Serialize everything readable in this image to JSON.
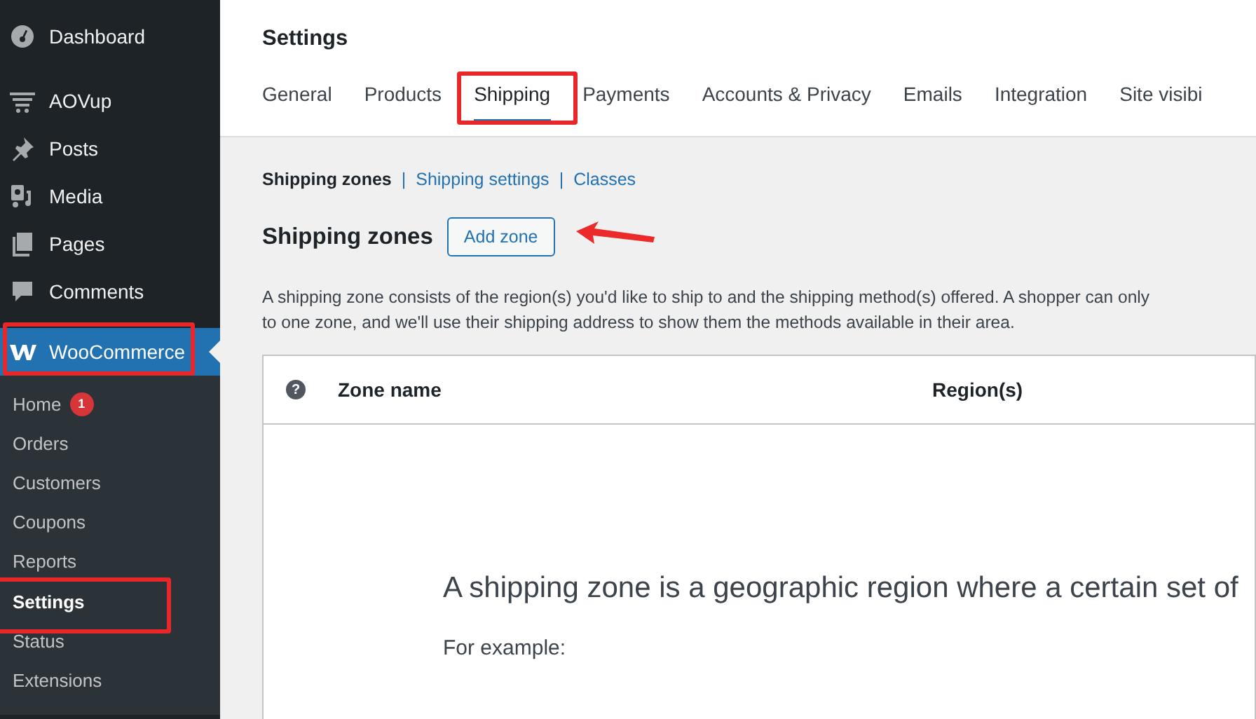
{
  "sidebar": {
    "items": [
      {
        "label": "Dashboard",
        "kind": "gauge",
        "selected": false
      },
      {
        "label": "AOVup",
        "kind": "cart",
        "selected": false
      },
      {
        "label": "Posts",
        "kind": "pin",
        "selected": false
      },
      {
        "label": "Media",
        "kind": "media",
        "selected": false
      },
      {
        "label": "Pages",
        "kind": "pages",
        "selected": false
      },
      {
        "label": "Comments",
        "kind": "comment",
        "selected": false
      },
      {
        "label": "WooCommerce",
        "kind": "woo",
        "selected": true,
        "highlighted": true
      }
    ],
    "submenu": [
      {
        "label": "Home",
        "badge": "1",
        "selected": false,
        "highlighted": false
      },
      {
        "label": "Orders",
        "selected": false,
        "highlighted": false
      },
      {
        "label": "Customers",
        "selected": false,
        "highlighted": false
      },
      {
        "label": "Coupons",
        "selected": false,
        "highlighted": false
      },
      {
        "label": "Reports",
        "selected": false,
        "highlighted": false
      },
      {
        "label": "Settings",
        "selected": true,
        "highlighted": true
      },
      {
        "label": "Status",
        "selected": false,
        "highlighted": false
      },
      {
        "label": "Extensions",
        "selected": false,
        "highlighted": false
      }
    ]
  },
  "page_title": "Settings",
  "tabs": [
    {
      "label": "General",
      "selected": false,
      "highlighted": false
    },
    {
      "label": "Products",
      "selected": false,
      "highlighted": false
    },
    {
      "label": "Shipping",
      "selected": true,
      "highlighted": true
    },
    {
      "label": "Payments",
      "selected": false,
      "highlighted": false
    },
    {
      "label": "Accounts & Privacy",
      "selected": false,
      "highlighted": false
    },
    {
      "label": "Emails",
      "selected": false,
      "highlighted": false
    },
    {
      "label": "Integration",
      "selected": false,
      "highlighted": false
    },
    {
      "label": "Site visibi",
      "selected": false,
      "highlighted": false
    }
  ],
  "subnav": {
    "divider": "|",
    "links": [
      {
        "label": "Shipping zones",
        "selected": true
      },
      {
        "label": "Shipping settings",
        "selected": false
      },
      {
        "label": "Classes",
        "selected": false
      }
    ]
  },
  "section": {
    "heading": "Shipping zones",
    "button": "Add zone",
    "arrow": true,
    "description": [
      "A shipping zone consists of the region(s) you'd like to ship to and the shipping method(s) offered. A shopper can only",
      "to one zone, and we'll use their shipping address to show them the methods available in their area."
    ]
  },
  "table": {
    "help_glyph": "?",
    "columns": [
      "Zone name",
      "Region(s)"
    ],
    "intro": "A shipping zone is a geographic region where a certain set of",
    "example": "For example:"
  }
}
